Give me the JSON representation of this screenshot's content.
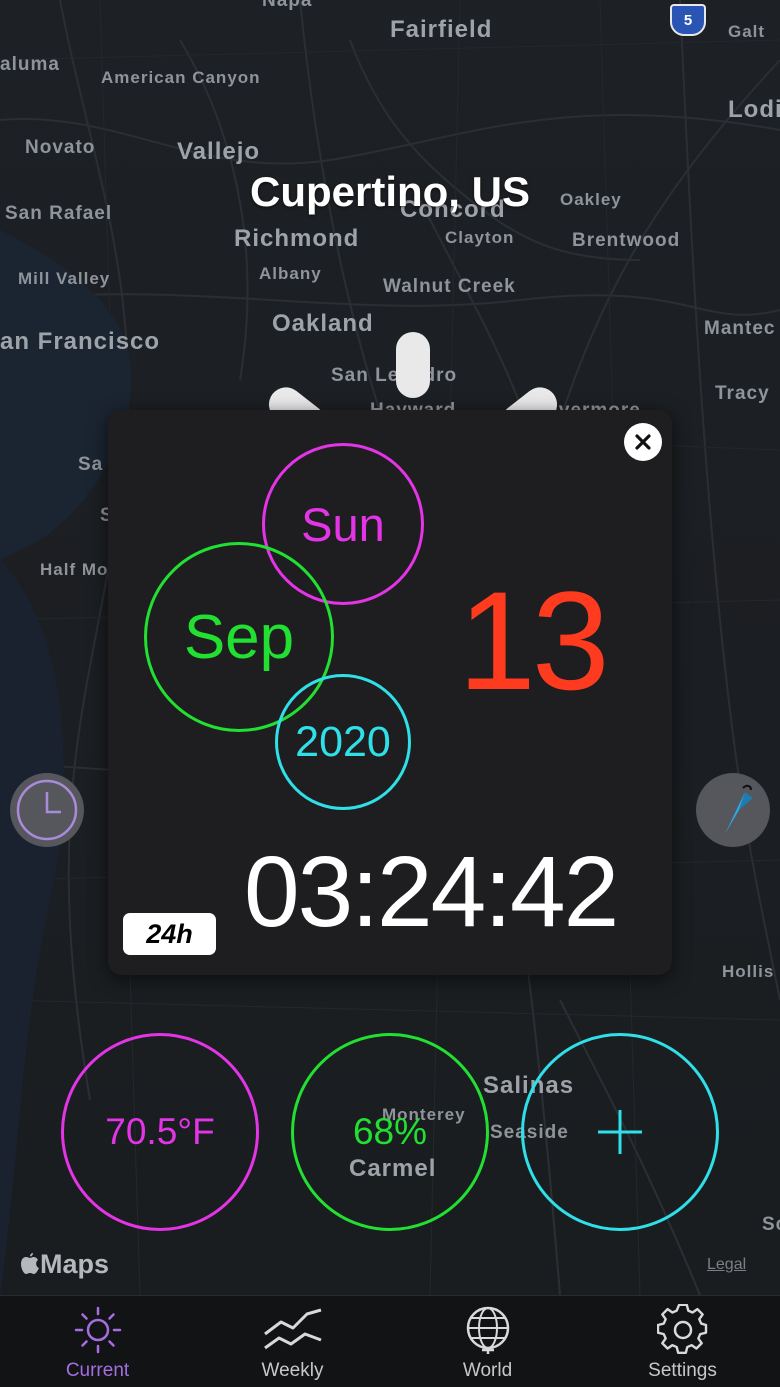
{
  "map": {
    "labels": [
      {
        "text": "Napa",
        "cls": ""
      },
      {
        "text": "Fairfield",
        "cls": "big"
      },
      {
        "text": "Galt",
        "cls": "small"
      },
      {
        "text": "aluma",
        "cls": ""
      },
      {
        "text": "American Canyon",
        "cls": "small"
      },
      {
        "text": "Lodi",
        "cls": ""
      },
      {
        "text": "Novato",
        "cls": ""
      },
      {
        "text": "Vallejo",
        "cls": "big"
      },
      {
        "text": "San Rafael",
        "cls": ""
      },
      {
        "text": "Concord",
        "cls": "big"
      },
      {
        "text": "Oakley",
        "cls": "small"
      },
      {
        "text": "Richmond",
        "cls": "big"
      },
      {
        "text": "Clayton",
        "cls": "small"
      },
      {
        "text": "Brentwood",
        "cls": ""
      },
      {
        "text": "Albany",
        "cls": "small"
      },
      {
        "text": "Mill Valley",
        "cls": "small"
      },
      {
        "text": "Walnut Creek",
        "cls": ""
      },
      {
        "text": "Oakland",
        "cls": "big"
      },
      {
        "text": "an Francisco",
        "cls": "big"
      },
      {
        "text": "Mantec",
        "cls": ""
      },
      {
        "text": "San Leandro",
        "cls": ""
      },
      {
        "text": "Tracy",
        "cls": ""
      },
      {
        "text": "Hayward",
        "cls": ""
      },
      {
        "text": "Livermore",
        "cls": ""
      },
      {
        "text": "Sa",
        "cls": ""
      },
      {
        "text": "S",
        "cls": ""
      },
      {
        "text": "Half Mo",
        "cls": "small"
      },
      {
        "text": "Hollis",
        "cls": "small"
      },
      {
        "text": "Salinas",
        "cls": "big"
      },
      {
        "text": "Seaside",
        "cls": ""
      },
      {
        "text": "Monterey",
        "cls": "small"
      },
      {
        "text": "Carmel",
        "cls": "big"
      },
      {
        "text": "Sc",
        "cls": ""
      }
    ],
    "highway_shield": "5",
    "maps_logo": "Maps",
    "legal": "Legal"
  },
  "location": {
    "title": "Cupertino, US"
  },
  "popup": {
    "weekday": "Sun",
    "month": "Sep",
    "year": "2020",
    "day": "13",
    "time": "03:24:42",
    "format_badge": "24h"
  },
  "colors": {
    "magenta": "#e335e6",
    "green": "#22e032",
    "cyan": "#2fe0e8",
    "red": "#ff3b1f",
    "purple_active": "#a46ee2"
  },
  "stats": {
    "temperature": "70.5°F",
    "humidity": "68%",
    "add_icon": "plus-icon"
  },
  "tabs": [
    {
      "label": "Current",
      "icon": "sun-icon",
      "active": true
    },
    {
      "label": "Weekly",
      "icon": "chart-icon",
      "active": false
    },
    {
      "label": "World",
      "icon": "globe-icon",
      "active": false
    },
    {
      "label": "Settings",
      "icon": "gear-icon",
      "active": false
    }
  ]
}
